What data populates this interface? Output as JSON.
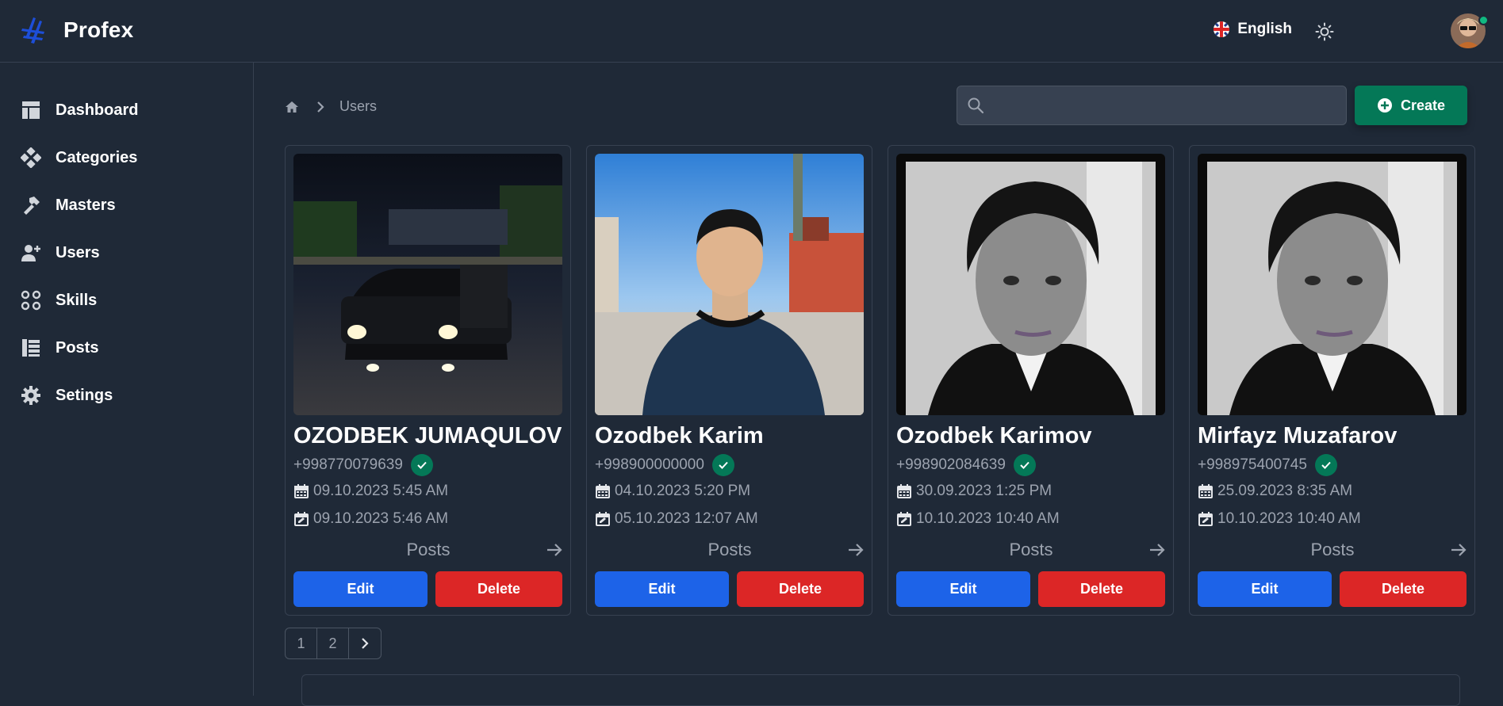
{
  "app": {
    "title": "Profex"
  },
  "header": {
    "language": "English"
  },
  "sidebar": {
    "items": [
      {
        "label": "Dashboard",
        "icon": "dashboard-icon"
      },
      {
        "label": "Categories",
        "icon": "categories-icon"
      },
      {
        "label": "Masters",
        "icon": "hammer-icon"
      },
      {
        "label": "Users",
        "icon": "user-plus-icon"
      },
      {
        "label": "Skills",
        "icon": "skills-icon"
      },
      {
        "label": "Posts",
        "icon": "list-icon"
      },
      {
        "label": "Setings",
        "icon": "gear-icon"
      }
    ]
  },
  "breadcrumb": {
    "current": "Users"
  },
  "search": {
    "placeholder": ""
  },
  "toolbar": {
    "create_label": "Create"
  },
  "users": [
    {
      "name": "OZODBEK JUMAQULOV",
      "phone": "+998770079639",
      "created": "09.10.2023 5:45 AM",
      "updated": "09.10.2023 5:46 AM",
      "posts_label": "Posts",
      "edit_label": "Edit",
      "delete_label": "Delete"
    },
    {
      "name": "Ozodbek Karim",
      "phone": "+998900000000",
      "created": "04.10.2023 5:20 PM",
      "updated": "05.10.2023 12:07 AM",
      "posts_label": "Posts",
      "edit_label": "Edit",
      "delete_label": "Delete"
    },
    {
      "name": "Ozodbek Karimov",
      "phone": "+998902084639",
      "created": "30.09.2023 1:25 PM",
      "updated": "10.10.2023 10:40 AM",
      "posts_label": "Posts",
      "edit_label": "Edit",
      "delete_label": "Delete"
    },
    {
      "name": "Mirfayz Muzafarov",
      "phone": "+998975400745",
      "created": "25.09.2023 8:35 AM",
      "updated": "10.10.2023 10:40 AM",
      "posts_label": "Posts",
      "edit_label": "Edit",
      "delete_label": "Delete"
    }
  ],
  "pagination": {
    "pages": [
      "1",
      "2"
    ]
  },
  "colors": {
    "background": "#1f2937",
    "accent_green": "#047857",
    "edit_blue": "#1d63e8",
    "delete_red": "#dc2626",
    "muted_text": "#9ca3af"
  }
}
